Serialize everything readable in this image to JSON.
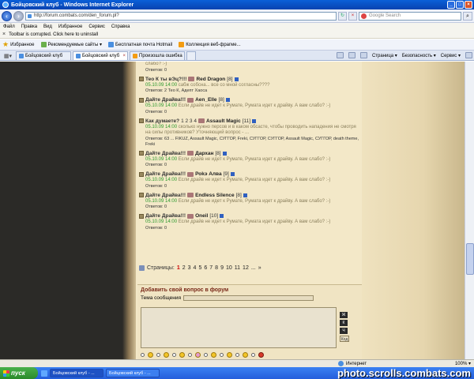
{
  "window": {
    "title": "Бойцовский клуб - Windows Internet Explorer"
  },
  "address": {
    "url": "http://forum.combats.com/den_forum.pl?",
    "search_placeholder": "Google Search"
  },
  "menu": {
    "items": [
      "Файл",
      "Правка",
      "Вид",
      "Избранное",
      "Сервис",
      "Справка"
    ]
  },
  "notify": {
    "text": "Toolbar is corrupted. Click here to uninstall"
  },
  "favorites": {
    "label": "Избранное",
    "items": [
      "Рекомендуемые сайты ▾",
      "Бесплатная почта Hotmail",
      "Коллекция веб-фрагме..."
    ]
  },
  "tabs": {
    "items": [
      "Бойцовский клуб",
      "Бойцовский клуб",
      "Произошла ошибка"
    ],
    "commands": [
      "Страница ▾",
      "Безопасность ▾",
      "Сервис ▾"
    ]
  },
  "forum": {
    "topics": [
      {
        "title": "",
        "author": "",
        "level": "",
        "body": "слабо? :-)",
        "meta": "Ответов: 0"
      },
      {
        "title": "Тео К ты вЭц?!!!",
        "author": "Red Dragon",
        "level": "[8]",
        "date": "05.10.09 14:00",
        "body": "сабж собсна... все со мной согласны????",
        "meta": "Ответов: 2   Тео К, Адепт Хаоса"
      },
      {
        "title": "Дайте Драйва!!!",
        "author": "Aen_Elle",
        "level": "[8]",
        "date": "05.10.09 14:00",
        "body": "Если драйв не идет к Румате, Румата идет к драйву. А вам слабо? :-)",
        "meta": "Ответов: 0"
      },
      {
        "title": "Как думаете?",
        "pages": "1 2 3 4",
        "author": "Assault Magic",
        "level": "[11]",
        "date": "05.10.09 14:00",
        "body": "сколько нужно персов и в каком обсасте, чтобы проводить нападения не смотря на силы противников? Уточняющий вопрос - ...",
        "meta": "Ответов: 63   ... FIKUZ, Assault Magic, СУГГОР, Freki, СУГГОР, СУГГОР, Assault Magic, СУГГОР, death theme, Freki"
      },
      {
        "title": "Дайте Драйва!!!",
        "author": "Дархан",
        "level": "[8]",
        "date": "05.10.09 14:00",
        "body": "Если драйв не идет к Румате, Румата идет к драйву. А вам слабо? :-)",
        "meta": "Ответов: 0"
      },
      {
        "title": "Дайте Драйва!!!",
        "author": "Роkэ Алва",
        "level": "[9]",
        "date": "05.10.09 14:00",
        "body": "Если драйв не идет к Румате, Румата идет к драйву. А вам слабо? :-)",
        "meta": "Ответов: 0"
      },
      {
        "title": "Дайте Драйва!!!",
        "author": "Endless Silence",
        "level": "[8]",
        "date": "05.10.09 14:00",
        "body": "Если драйв не идет к Румате, Румата идет к драйву. А вам слабо? :-)",
        "meta": "Ответов: 0"
      },
      {
        "title": "Дайте Драйва!!!",
        "author": "Oneil",
        "level": "[10]",
        "date": "05.10.09 14:00",
        "body": "Если драйв не идет к Румате, Румата идет к драйву. А вам слабо? :-)",
        "meta": "Ответов: 0"
      }
    ],
    "pages_label": "Страницы:",
    "current_page": "1",
    "pages": [
      "2",
      "3",
      "4",
      "5",
      "6",
      "7",
      "8",
      "9",
      "10",
      "11",
      "12",
      "...",
      "»"
    ]
  },
  "new_question": {
    "title": "Добавить свой вопрос в форум",
    "subject_label": "Тема сообщения",
    "format_buttons": [
      "Ж",
      "К",
      "Ч",
      "Код"
    ]
  },
  "status": {
    "zone": "Интернет",
    "zoom": "100% ▾"
  },
  "taskbar": {
    "start": "пуск",
    "buttons": [
      "Бойцовский клуб - ...",
      "Бойцовский клуб - ..."
    ],
    "watermark": "photo.scrolls.combats.com"
  }
}
